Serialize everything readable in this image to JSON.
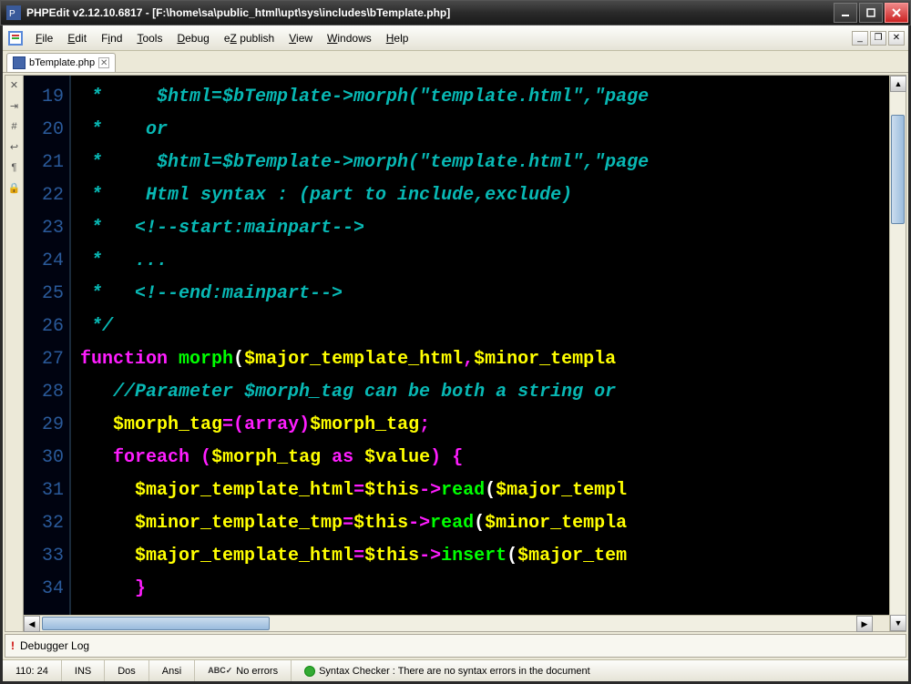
{
  "title": "PHPEdit v2.12.10.6817 - [F:\\home\\sa\\public_html\\upt\\sys\\includes\\bTemplate.php]",
  "menus": {
    "file": "File",
    "edit": "Edit",
    "find": "Find",
    "tools": "Tools",
    "debug": "Debug",
    "ez": "eZ publish",
    "view": "View",
    "windows": "Windows",
    "help": "Help"
  },
  "tab": {
    "name": "bTemplate.php"
  },
  "gutter": [
    "✕",
    "⇥",
    "#",
    "↩",
    "¶",
    "🔒"
  ],
  "line_numbers": [
    "19",
    "20",
    "21",
    "22",
    "23",
    "24",
    "25",
    "26",
    "27",
    "28",
    "29",
    "30",
    "31",
    "32",
    "33",
    "34"
  ],
  "code_lines": [
    {
      "spans": [
        {
          "cls": "c-comment",
          "t": " *     $html=$bTemplate->morph(\"template.html\",\"page"
        }
      ]
    },
    {
      "spans": [
        {
          "cls": "c-comment",
          "t": " *    or"
        }
      ]
    },
    {
      "spans": [
        {
          "cls": "c-comment",
          "t": " *     $html=$bTemplate->morph(\"template.html\",\"page"
        }
      ]
    },
    {
      "spans": [
        {
          "cls": "c-comment",
          "t": " *    Html syntax : (part to include,exclude)"
        }
      ]
    },
    {
      "spans": [
        {
          "cls": "c-comment",
          "t": " *   <!--start:mainpart-->"
        }
      ]
    },
    {
      "spans": [
        {
          "cls": "c-comment",
          "t": " *   ..."
        }
      ]
    },
    {
      "spans": [
        {
          "cls": "c-comment",
          "t": " *   <!--end:mainpart-->"
        }
      ]
    },
    {
      "spans": [
        {
          "cls": "c-comment",
          "t": " */"
        }
      ]
    },
    {
      "spans": [
        {
          "cls": "c-keyword",
          "t": "function "
        },
        {
          "cls": "c-func",
          "t": "morph"
        },
        {
          "cls": "c-paren",
          "t": "("
        },
        {
          "cls": "c-var",
          "t": "$major_template_html"
        },
        {
          "cls": "c-op",
          "t": ","
        },
        {
          "cls": "c-var",
          "t": "$minor_templa"
        }
      ]
    },
    {
      "spans": [
        {
          "cls": "c-comment",
          "t": "   //Parameter $morph_tag can be both a string or "
        }
      ]
    },
    {
      "spans": [
        {
          "cls": "c-plain",
          "t": "   "
        },
        {
          "cls": "c-var",
          "t": "$morph_tag"
        },
        {
          "cls": "c-op",
          "t": "=("
        },
        {
          "cls": "c-keyword",
          "t": "array"
        },
        {
          "cls": "c-op",
          "t": ")"
        },
        {
          "cls": "c-var",
          "t": "$morph_tag"
        },
        {
          "cls": "c-op",
          "t": ";"
        }
      ]
    },
    {
      "spans": [
        {
          "cls": "c-plain",
          "t": "   "
        },
        {
          "cls": "c-keyword",
          "t": "foreach"
        },
        {
          "cls": "c-plain",
          "t": " "
        },
        {
          "cls": "c-op",
          "t": "("
        },
        {
          "cls": "c-var",
          "t": "$morph_tag"
        },
        {
          "cls": "c-plain",
          "t": " "
        },
        {
          "cls": "c-keyword",
          "t": "as"
        },
        {
          "cls": "c-plain",
          "t": " "
        },
        {
          "cls": "c-var",
          "t": "$value"
        },
        {
          "cls": "c-op",
          "t": ")"
        },
        {
          "cls": "c-plain",
          "t": " "
        },
        {
          "cls": "c-op",
          "t": "{"
        }
      ]
    },
    {
      "spans": [
        {
          "cls": "c-plain",
          "t": "     "
        },
        {
          "cls": "c-var",
          "t": "$major_template_html"
        },
        {
          "cls": "c-op",
          "t": "="
        },
        {
          "cls": "c-var",
          "t": "$this"
        },
        {
          "cls": "c-op",
          "t": "->"
        },
        {
          "cls": "c-this",
          "t": "read"
        },
        {
          "cls": "c-paren",
          "t": "("
        },
        {
          "cls": "c-var",
          "t": "$major_templ"
        }
      ]
    },
    {
      "spans": [
        {
          "cls": "c-plain",
          "t": "     "
        },
        {
          "cls": "c-var",
          "t": "$minor_template_tmp"
        },
        {
          "cls": "c-op",
          "t": "="
        },
        {
          "cls": "c-var",
          "t": "$this"
        },
        {
          "cls": "c-op",
          "t": "->"
        },
        {
          "cls": "c-this",
          "t": "read"
        },
        {
          "cls": "c-paren",
          "t": "("
        },
        {
          "cls": "c-var",
          "t": "$minor_templa"
        }
      ]
    },
    {
      "spans": [
        {
          "cls": "c-plain",
          "t": "     "
        },
        {
          "cls": "c-var",
          "t": "$major_template_html"
        },
        {
          "cls": "c-op",
          "t": "="
        },
        {
          "cls": "c-var",
          "t": "$this"
        },
        {
          "cls": "c-op",
          "t": "->"
        },
        {
          "cls": "c-this",
          "t": "insert"
        },
        {
          "cls": "c-paren",
          "t": "("
        },
        {
          "cls": "c-var",
          "t": "$major_tem"
        }
      ]
    },
    {
      "spans": [
        {
          "cls": "c-plain",
          "t": "     "
        },
        {
          "cls": "c-op",
          "t": "}"
        }
      ]
    }
  ],
  "bottom_panel": {
    "label": "Debugger Log"
  },
  "status": {
    "position": "110: 24",
    "ins": "INS",
    "dos": "Dos",
    "ansi": "Ansi",
    "no_errors": "No errors",
    "syntax": "Syntax Checker : There are no syntax errors in the document"
  }
}
